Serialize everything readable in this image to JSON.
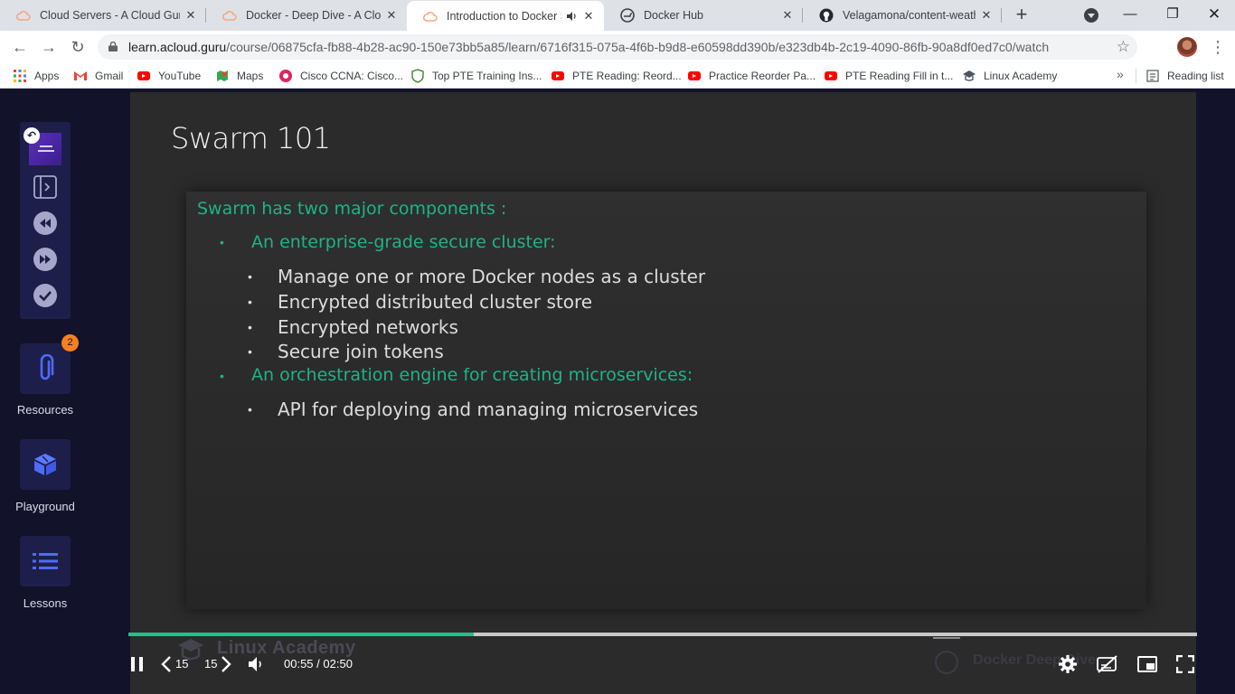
{
  "browser": {
    "tabs": [
      {
        "title": "Cloud Servers - A Cloud Guru",
        "favicon": "acg-cloud-icon",
        "active": false
      },
      {
        "title": "Docker - Deep Dive - A Cloud Guru",
        "favicon": "acg-cloud-icon",
        "active": false
      },
      {
        "title": "Introduction to Docker Swarm",
        "favicon": "acg-cloud-icon",
        "active": true,
        "audio": true
      },
      {
        "title": "Docker Hub",
        "favicon": "docker-icon",
        "active": false
      },
      {
        "title": "Velagamona/content-weather",
        "favicon": "github-icon",
        "active": false
      }
    ],
    "url": {
      "host": "learn.acloud.guru",
      "path": "/course/06875cfa-fb88-4b28-ac90-150e73bb5a85/learn/6716f315-075a-4f6b-b9d8-e60598dd390b/e323db4b-2c19-4090-86fb-90a8df0ed7c0/watch"
    },
    "bookmarks": [
      {
        "label": "Apps",
        "icon": "apps-grid-icon"
      },
      {
        "label": "Gmail",
        "icon": "gmail-icon"
      },
      {
        "label": "YouTube",
        "icon": "youtube-icon"
      },
      {
        "label": "Maps",
        "icon": "maps-icon"
      },
      {
        "label": "Cisco CCNA: Cisco...",
        "icon": "cisco-icon"
      },
      {
        "label": "Top PTE Training Ins...",
        "icon": "pte-icon"
      },
      {
        "label": "PTE Reading: Reord...",
        "icon": "youtube-icon"
      },
      {
        "label": "Practice Reorder Pa...",
        "icon": "youtube-icon"
      },
      {
        "label": "PTE Reading Fill in t...",
        "icon": "youtube-icon"
      },
      {
        "label": "Linux Academy",
        "icon": "linux-academy-icon"
      }
    ],
    "more_bookmarks": "»",
    "reading_list": "Reading list"
  },
  "sidebar": {
    "resources_label": "Resources",
    "resources_badge": "2",
    "playground_label": "Playground",
    "lessons_label": "Lessons"
  },
  "slide": {
    "title": "Swarm 101",
    "intro": "Swarm has two major components :",
    "section1": "An enterprise-grade secure cluster:",
    "section1_items": [
      "Manage one or more Docker nodes as a cluster",
      "Encrypted distributed cluster store",
      "Encrypted networks",
      "Secure join tokens"
    ],
    "section2": "An orchestration engine for creating microservices:",
    "section2_items": [
      "API for deploying and managing microservices"
    ]
  },
  "player": {
    "progress_fraction": 0.3235,
    "skip_back": "15",
    "skip_forward": "15",
    "current_time": "00:55",
    "duration": "02:50",
    "time_separator": " / ",
    "watermark_left": "Linux Academy",
    "watermark_right": "Docker Deep Dive"
  },
  "colors": {
    "accent_green": "#1ec28b",
    "slide_teal": "#1eb387",
    "sidebar_bg": "#12122a",
    "tile_bg": "#1e1e4a",
    "badge_orange": "#f4811f"
  }
}
